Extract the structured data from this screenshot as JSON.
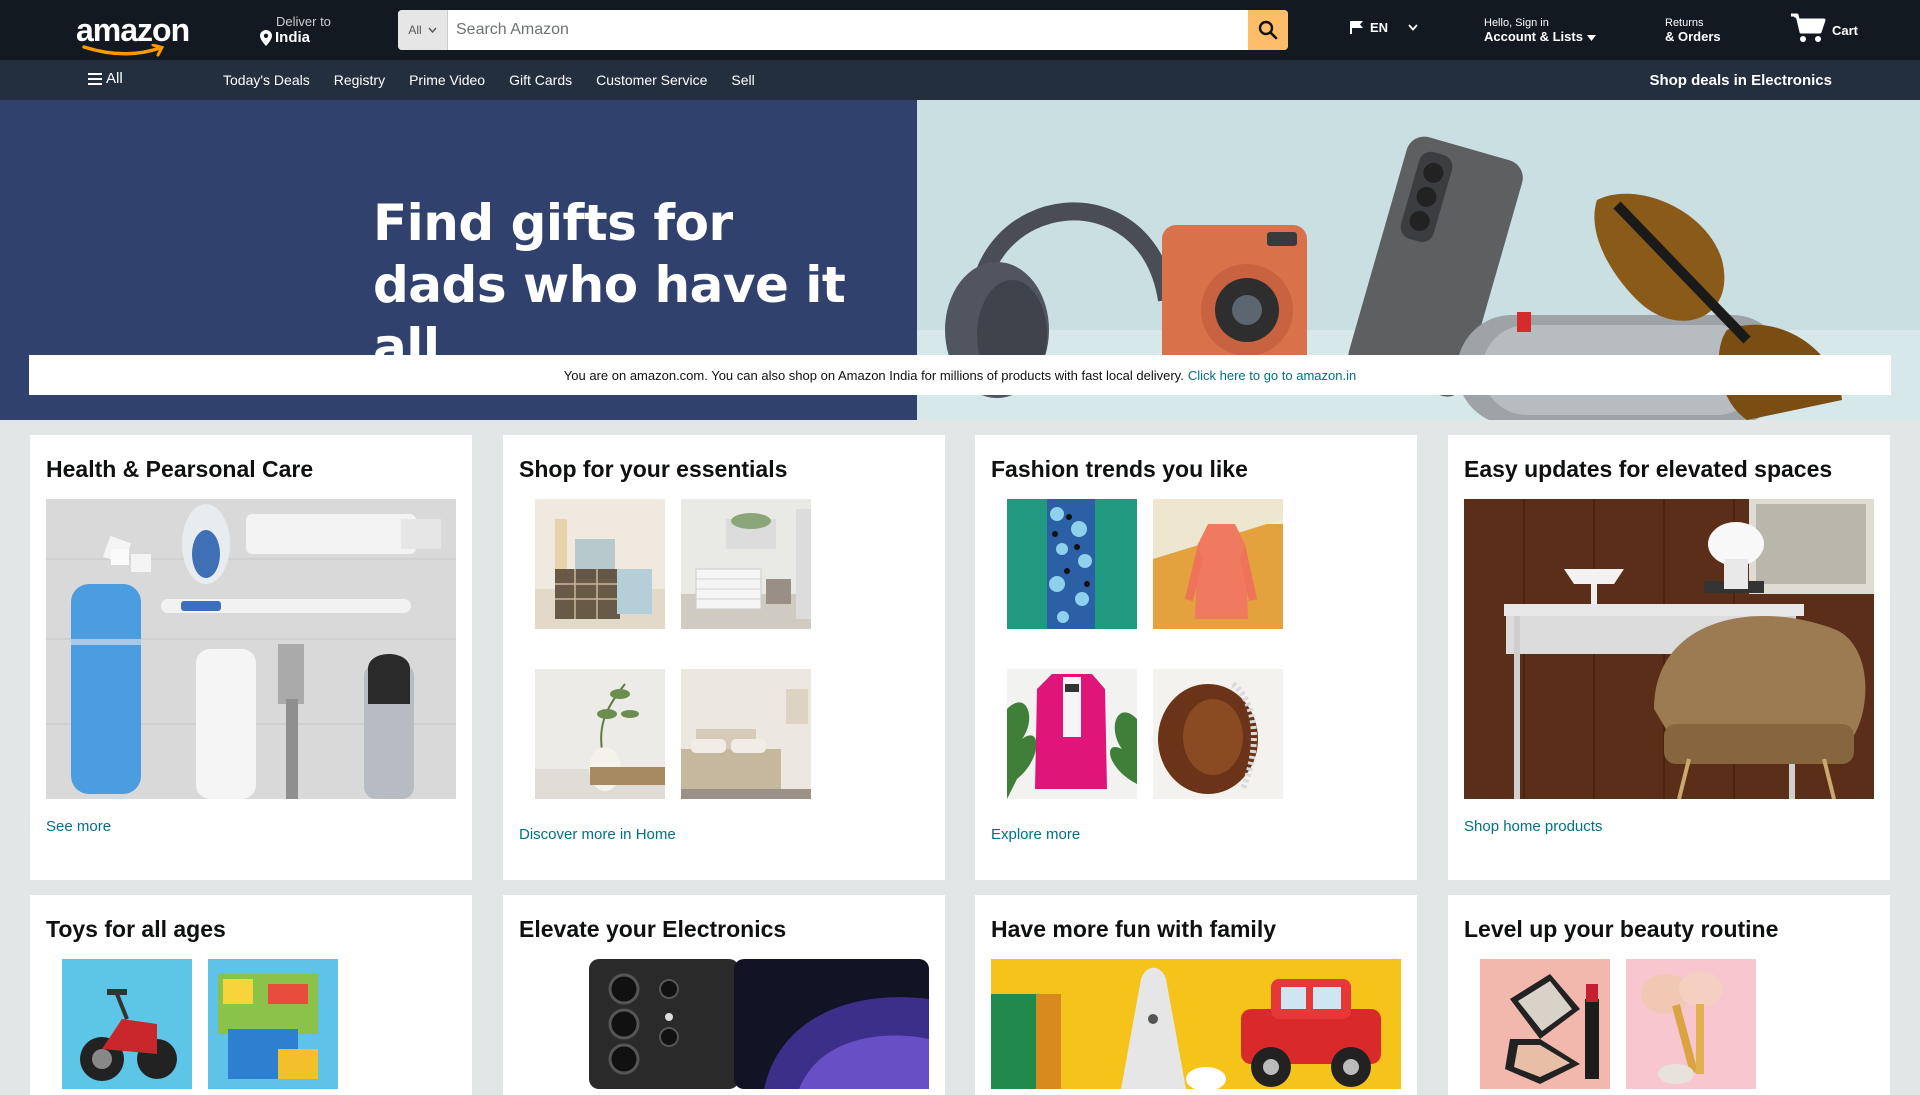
{
  "header": {
    "logo_text": "amazon",
    "deliver_small": "Deliver to",
    "deliver_big": "India",
    "search_category": "All",
    "search_placeholder": "Search Amazon",
    "language": "EN",
    "account_small": "Hello, Sign in",
    "account_big": "Account & Lists",
    "orders_small": "Returns",
    "orders_big": "& Orders",
    "cart_label": "Cart"
  },
  "subnav": {
    "all_label": "All",
    "links": [
      "Today's Deals",
      "Registry",
      "Prime Video",
      "Gift Cards",
      "Customer Service",
      "Sell"
    ],
    "deals_label": "Shop deals in Electronics"
  },
  "hero": {
    "title_line1": "Find gifts for",
    "title_line2": "dads who have it all",
    "notice_text": "You are on amazon.com. You can also shop on Amazon India for millions of products with fast local delivery.",
    "notice_link": "Click here to go to amazon.in"
  },
  "cards": [
    {
      "title": "Health & Pearsonal Care",
      "link": "See more"
    },
    {
      "title": "Shop for your essentials",
      "link": "Discover more in Home"
    },
    {
      "title": "Fashion trends you like",
      "link": "Explore more"
    },
    {
      "title": "Easy updates for elevated spaces",
      "link": "Shop home products"
    },
    {
      "title": "Toys for all ages",
      "link": ""
    },
    {
      "title": "Elevate your Electronics",
      "link": ""
    },
    {
      "title": "Have more fun with family",
      "link": ""
    },
    {
      "title": "Level up your beauty routine",
      "link": ""
    }
  ],
  "colors": {
    "nav_bg": "#131921",
    "subnav_bg": "#232f3e",
    "search_button": "#febd69",
    "link": "#007185",
    "hero_left": "#31416e",
    "page_bg": "#e3e6e6"
  },
  "icons": [
    "location-pin-icon",
    "search-icon",
    "flag-icon",
    "chevron-down-icon",
    "cart-icon",
    "menu-icon"
  ]
}
